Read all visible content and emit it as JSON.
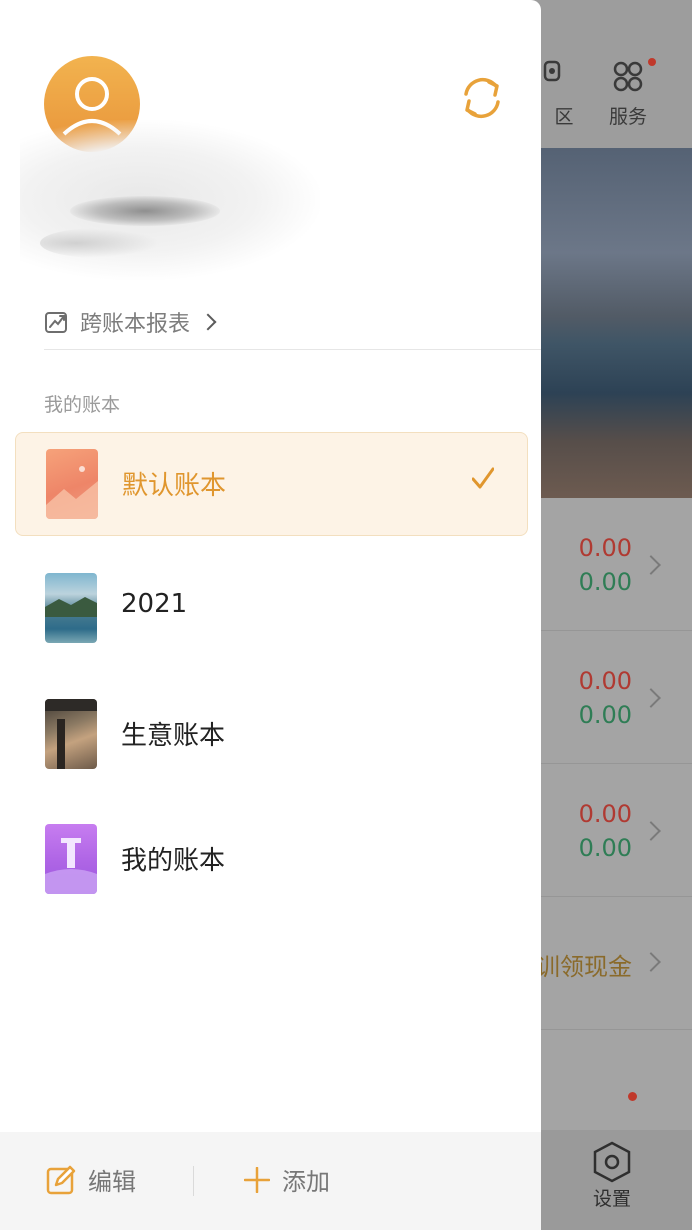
{
  "drawer": {
    "cross_book_report": "跨账本报表",
    "section_label": "我的账本",
    "books": [
      {
        "name": "默认账本",
        "selected": true
      },
      {
        "name": "2021",
        "selected": false
      },
      {
        "name": "生意账本",
        "selected": false
      },
      {
        "name": "我的账本",
        "selected": false
      }
    ],
    "edit_label": "编辑",
    "add_label": "添加"
  },
  "background": {
    "tab_partial": "区",
    "tab_service": "服务",
    "rows": [
      {
        "out": "0.00",
        "in": "0.00"
      },
      {
        "out": "0.00",
        "in": "0.00"
      },
      {
        "out": "0.00",
        "in": "0.00"
      }
    ],
    "promo_text": "训领现金",
    "settings_label": "设置"
  },
  "colors": {
    "accent": "#e0962e",
    "expense_red": "#c0392b",
    "income_green": "#2e8b57",
    "selected_bg": "#fdf3e6"
  }
}
